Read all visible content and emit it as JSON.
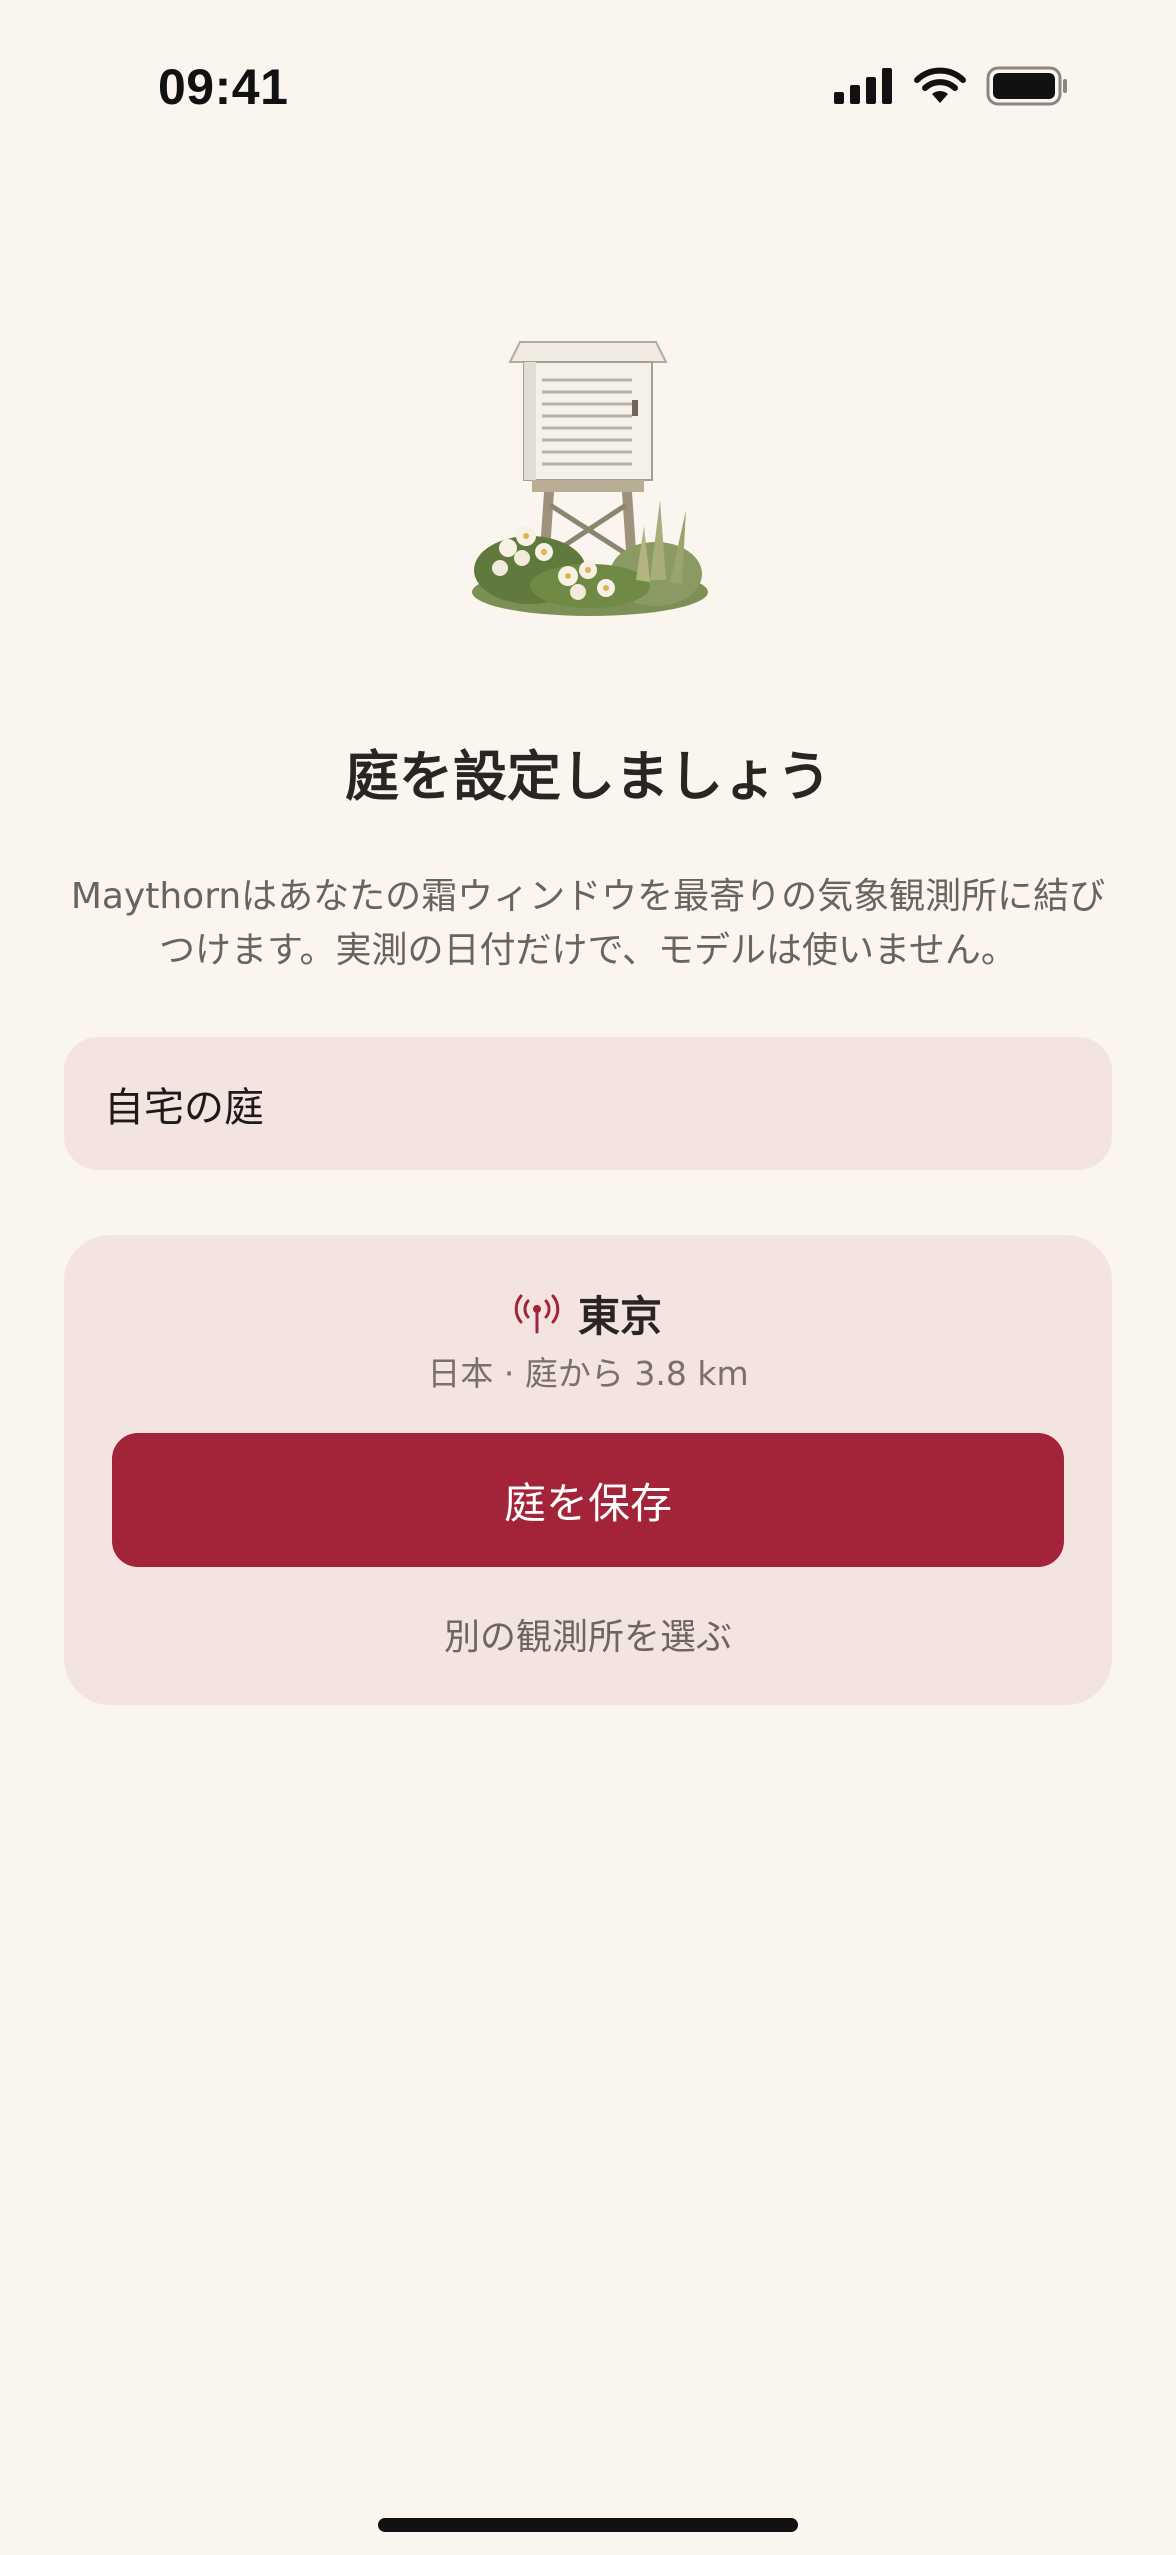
{
  "status_bar": {
    "time": "09:41"
  },
  "onboarding": {
    "title": "庭を設定しましょう",
    "description": "Maythornはあなたの霜ウィンドウを最寄りの気象観測所に結びつけます。実測の日付だけで、モデルは使いません。",
    "garden_name": "自宅の庭"
  },
  "station": {
    "icon": "antenna-signal-icon",
    "name": "東京",
    "meta": "日本 · 庭から 3.8 km",
    "save_label": "庭を保存",
    "alt_label": "別の観測所を選ぶ"
  },
  "colors": {
    "background": "#faf5ef",
    "accent": "#a32338",
    "card": "#f3e4e2"
  }
}
